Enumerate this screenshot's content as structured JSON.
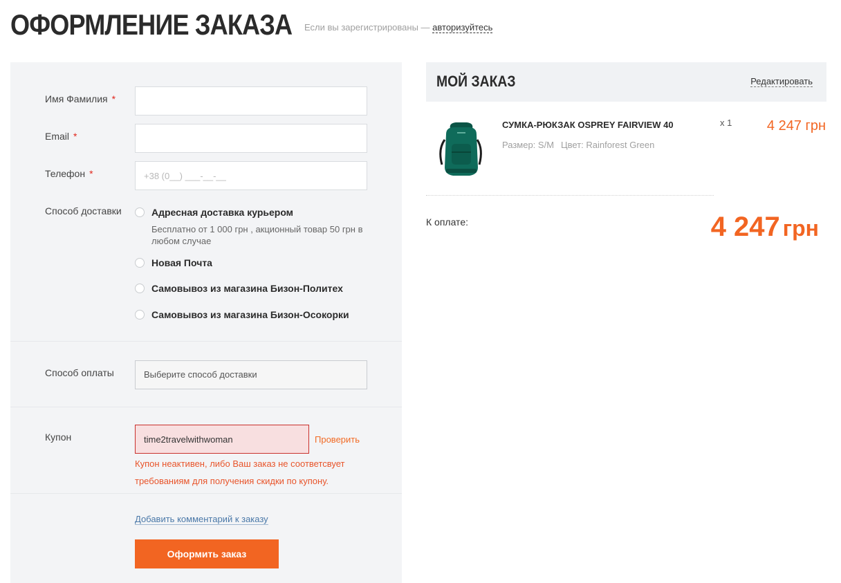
{
  "page": {
    "title": "ОФОРМЛЕНИЕ ЗАКАЗА",
    "login_hint": "Если вы зарегистрированы —",
    "login_link": "авторизуйтесь"
  },
  "form": {
    "name": {
      "label": "Имя Фамилия",
      "required_mark": "*",
      "value": ""
    },
    "email": {
      "label": "Email",
      "required_mark": "*",
      "value": ""
    },
    "phone": {
      "label": "Телефон",
      "required_mark": "*",
      "placeholder": "+38 (0__) ___-__-__"
    },
    "delivery": {
      "label": "Способ доставки",
      "options": [
        {
          "label": "Адресная доставка курьером",
          "note": "Бесплатно от 1 000 грн , акционный товар 50 грн в любом случае"
        },
        {
          "label": "Новая Почта"
        },
        {
          "label": "Самовывоз из магазина Бизон-Политех"
        },
        {
          "label": "Самовывоз из магазина Бизон-Осокорки"
        }
      ]
    },
    "payment": {
      "label": "Способ оплаты",
      "selected": "Выберите способ доставки"
    },
    "coupon": {
      "label": "Купон",
      "value": "time2travelwithwoman",
      "check_label": "Проверить",
      "error": "Купон неактивен, либо Ваш заказ не соответсвует требованиям для получения скидки по купону."
    },
    "comment_link": "Добавить комментарий к заказу",
    "submit_label": "Оформить заказ"
  },
  "order": {
    "title": "МОЙ ЗАКАЗ",
    "edit_label": "Редактировать",
    "item": {
      "name": "СУМКА-РЮКЗАК OSPREY FAIRVIEW 40",
      "size": "Размер: S/M",
      "color": "Цвет: Rainforest Green",
      "qty": "x 1",
      "price": "4 247 грн",
      "image_icon": "backpack-icon"
    },
    "total": {
      "label": "К оплате:",
      "amount": "4 247",
      "currency": "грн"
    }
  },
  "colors": {
    "accent": "#f26522",
    "error": "#c9302c",
    "panel": "#f3f4f6",
    "backpack": "#0f6b5a"
  }
}
